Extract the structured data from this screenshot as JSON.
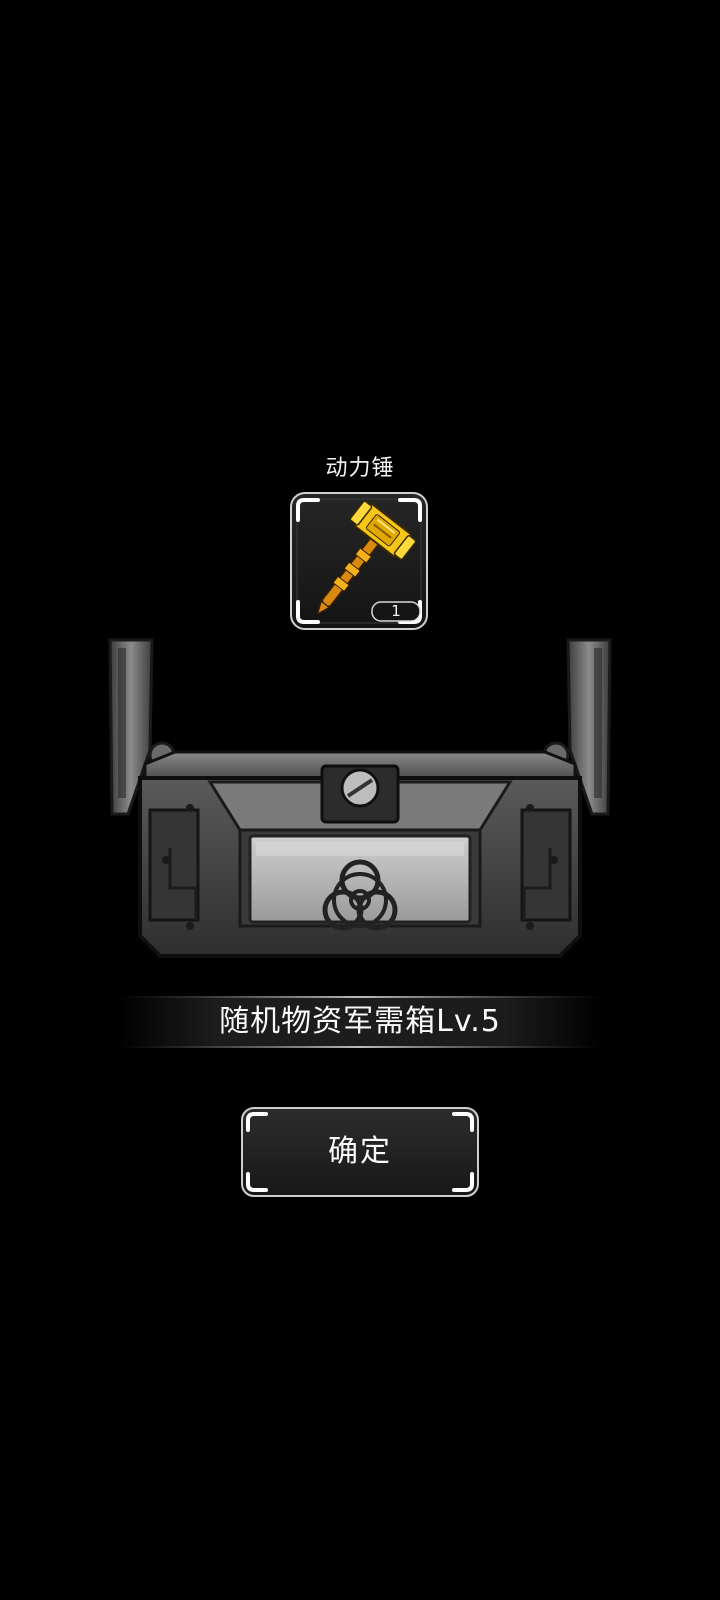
{
  "reward": {
    "item_name": "动力锤",
    "item_icon": "power-hammer-icon",
    "item_count": "1",
    "rarity_color": "#f0b400"
  },
  "crate": {
    "icon": "biohazard-crate-icon",
    "title": "随机物资军需箱Lv.5"
  },
  "actions": {
    "confirm_label": "确定"
  }
}
